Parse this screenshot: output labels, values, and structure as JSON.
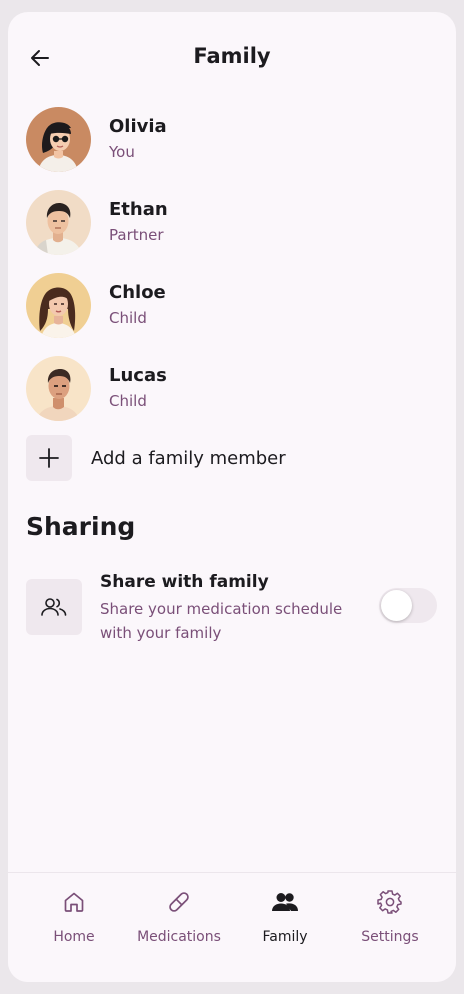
{
  "header": {
    "title": "Family",
    "back_icon": "arrow-left-icon"
  },
  "members": [
    {
      "name": "Olivia",
      "role": "You"
    },
    {
      "name": "Ethan",
      "role": "Partner"
    },
    {
      "name": "Chloe",
      "role": "Child"
    },
    {
      "name": "Lucas",
      "role": "Child"
    }
  ],
  "add_member": {
    "label": "Add a family member",
    "icon": "plus-icon"
  },
  "sharing": {
    "section_title": "Sharing",
    "title": "Share with family",
    "description": "Share your medication schedule with your family",
    "icon": "users-icon",
    "toggle_on": false
  },
  "nav": {
    "items": [
      {
        "label": "Home",
        "icon": "home-icon",
        "active": false
      },
      {
        "label": "Medications",
        "icon": "pill-icon",
        "active": false
      },
      {
        "label": "Family",
        "icon": "users-icon",
        "active": true
      },
      {
        "label": "Settings",
        "icon": "gear-icon",
        "active": false
      }
    ]
  },
  "colors": {
    "background": "#fbf7fb",
    "secondary_text": "#7a4f78",
    "tile": "#efe8ee",
    "primary_text": "#1c1b1f"
  }
}
